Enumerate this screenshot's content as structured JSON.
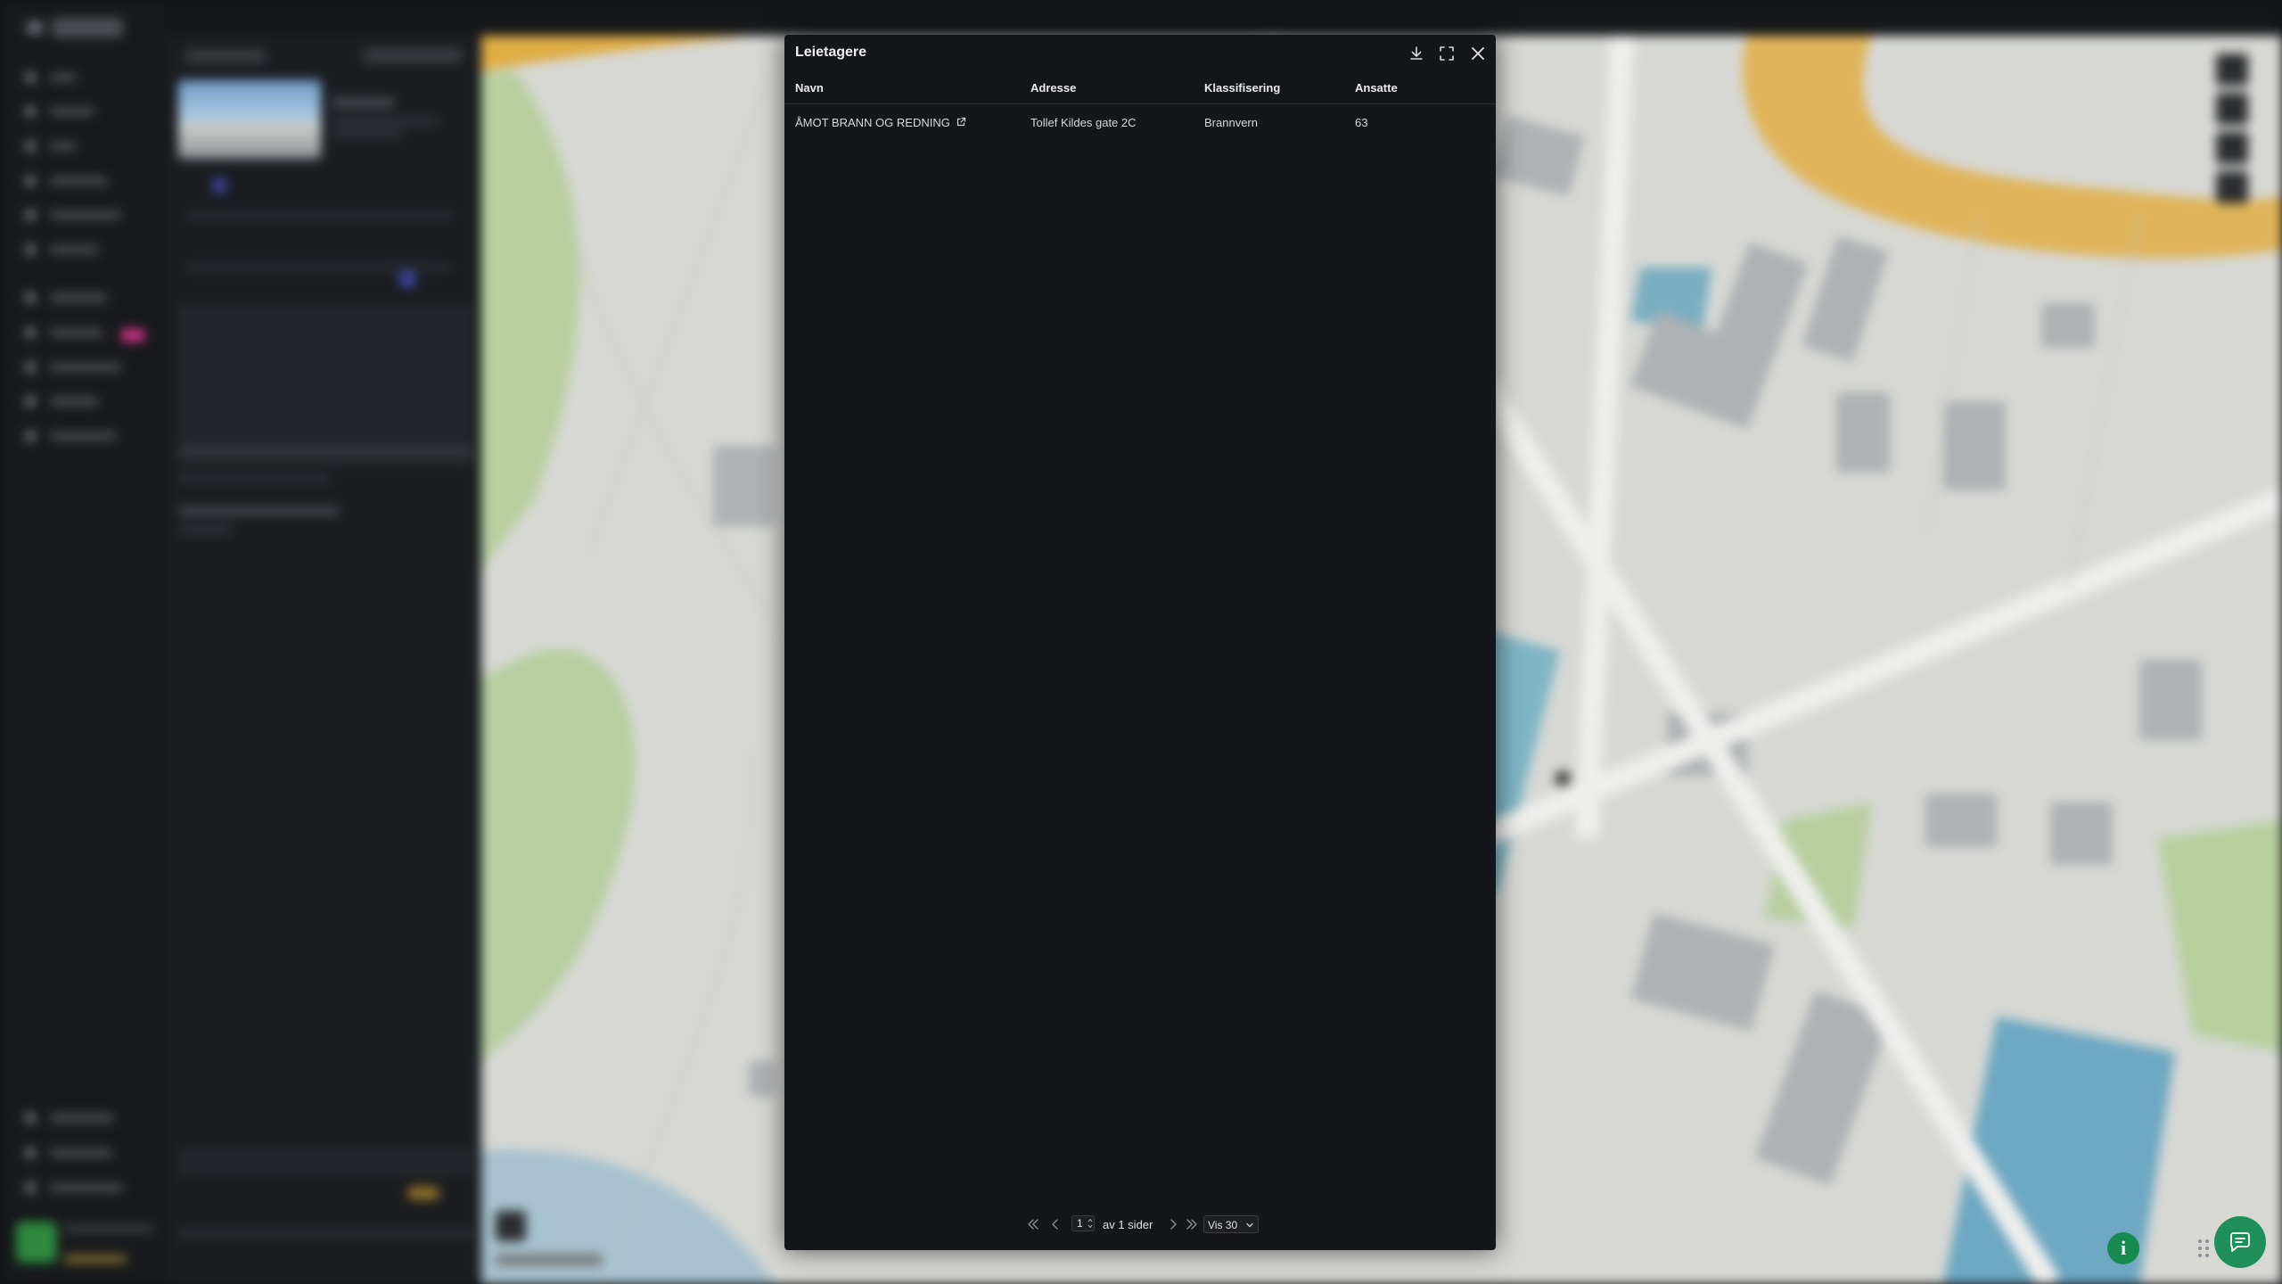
{
  "modal": {
    "title": "Leietagere",
    "columns": [
      "Navn",
      "Adresse",
      "Klassifisering",
      "Ansatte"
    ],
    "rows": [
      {
        "navn": "ÅMOT BRANN OG REDNING",
        "adresse": "Tollef Kildes gate 2C",
        "klassifisering": "Brannvern",
        "ansatte": "63"
      }
    ],
    "icons": {
      "download": "download-icon",
      "fullscreen": "fullscreen-icon",
      "close": "close-icon",
      "external_link": "external-link-icon"
    }
  },
  "pagination": {
    "page": "1",
    "of_text": "av 1 sider",
    "page_size": "Vis 30",
    "icons": [
      "first-page-icon",
      "prev-page-icon",
      "next-page-icon",
      "last-page-icon",
      "chevron-down-icon"
    ]
  },
  "floating": {
    "info_label": "i",
    "icons": [
      "info-icon",
      "drag-handle-icon",
      "chat-icon"
    ]
  },
  "colors": {
    "accent_green": "#1e8f58",
    "badge_pink": "#d2348a",
    "modal_bg": "#141619"
  }
}
